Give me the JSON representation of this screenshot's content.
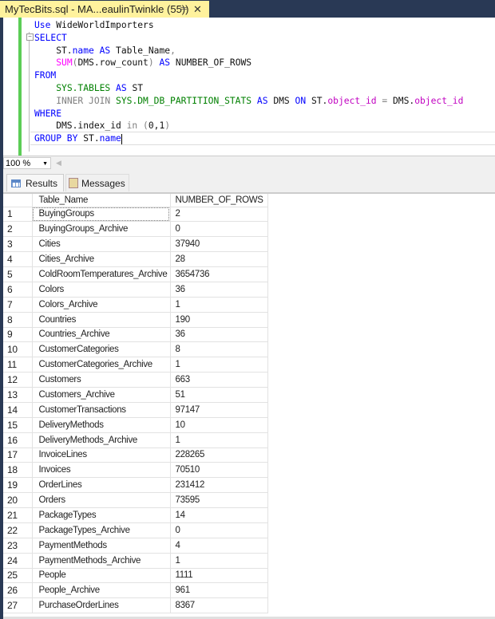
{
  "document_tab": {
    "title": "MyTecBits.sql - MA...eaulinTwinkle (55))",
    "pin_icon": "pin-icon",
    "close_icon": "close-icon"
  },
  "editor": {
    "lines": [
      [
        [
          "Use ",
          "kw"
        ],
        [
          "WideWorldImporters",
          ""
        ]
      ],
      [
        [
          "SELECT",
          "kw"
        ]
      ],
      [
        [
          "    ST.",
          ""
        ],
        [
          "name",
          "kw"
        ],
        [
          " AS ",
          "kw"
        ],
        [
          "Table_Name",
          ""
        ],
        [
          ",",
          "op"
        ]
      ],
      [
        [
          "    ",
          ""
        ],
        [
          "SUM",
          "fn"
        ],
        [
          "(",
          "op"
        ],
        [
          "DMS.row_count",
          ""
        ],
        [
          ")",
          "op"
        ],
        [
          " AS ",
          "kw"
        ],
        [
          "NUMBER_OF_ROWS",
          ""
        ]
      ],
      [
        [
          "FROM",
          "kw"
        ]
      ],
      [
        [
          "    ",
          ""
        ],
        [
          "SYS.TABLES",
          "sys"
        ],
        [
          " AS ",
          "kw"
        ],
        [
          "ST",
          ""
        ]
      ],
      [
        [
          "    ",
          ""
        ],
        [
          "INNER JOIN ",
          "op"
        ],
        [
          "SYS.DM_DB_PARTITION_STATS",
          "sys"
        ],
        [
          " AS ",
          "kw"
        ],
        [
          "DMS ",
          ""
        ],
        [
          "ON ",
          "kw"
        ],
        [
          "ST.",
          ""
        ],
        [
          "object_id",
          "pm"
        ],
        [
          " = ",
          "op"
        ],
        [
          "DMS.",
          ""
        ],
        [
          "object_id",
          "pm"
        ]
      ],
      [
        [
          "WHERE",
          "kw"
        ]
      ],
      [
        [
          "    DMS.index_id ",
          ""
        ],
        [
          "in ",
          "op"
        ],
        [
          "(",
          "op"
        ],
        [
          "0",
          ""
        ],
        [
          ",",
          ""
        ],
        [
          "1",
          ""
        ],
        [
          ")",
          "op"
        ]
      ],
      [
        [
          "GROUP BY ",
          "kw"
        ],
        [
          "ST.",
          ""
        ],
        [
          "name",
          "kw"
        ]
      ]
    ]
  },
  "zoom": {
    "value": "100 %"
  },
  "results_tabs": [
    {
      "label": "Results",
      "icon": "grid-icon"
    },
    {
      "label": "Messages",
      "icon": "messages-icon"
    }
  ],
  "grid": {
    "columns": [
      "Table_Name",
      "NUMBER_OF_ROWS"
    ],
    "rows": [
      [
        "BuyingGroups",
        "2"
      ],
      [
        "BuyingGroups_Archive",
        "0"
      ],
      [
        "Cities",
        "37940"
      ],
      [
        "Cities_Archive",
        "28"
      ],
      [
        "ColdRoomTemperatures_Archive",
        "3654736"
      ],
      [
        "Colors",
        "36"
      ],
      [
        "Colors_Archive",
        "1"
      ],
      [
        "Countries",
        "190"
      ],
      [
        "Countries_Archive",
        "36"
      ],
      [
        "CustomerCategories",
        "8"
      ],
      [
        "CustomerCategories_Archive",
        "1"
      ],
      [
        "Customers",
        "663"
      ],
      [
        "Customers_Archive",
        "51"
      ],
      [
        "CustomerTransactions",
        "97147"
      ],
      [
        "DeliveryMethods",
        "10"
      ],
      [
        "DeliveryMethods_Archive",
        "1"
      ],
      [
        "InvoiceLines",
        "228265"
      ],
      [
        "Invoices",
        "70510"
      ],
      [
        "OrderLines",
        "231412"
      ],
      [
        "Orders",
        "73595"
      ],
      [
        "PackageTypes",
        "14"
      ],
      [
        "PackageTypes_Archive",
        "0"
      ],
      [
        "PaymentMethods",
        "4"
      ],
      [
        "PaymentMethods_Archive",
        "1"
      ],
      [
        "People",
        "1111"
      ],
      [
        "People_Archive",
        "961"
      ],
      [
        "PurchaseOrderLines",
        "8367"
      ]
    ]
  }
}
